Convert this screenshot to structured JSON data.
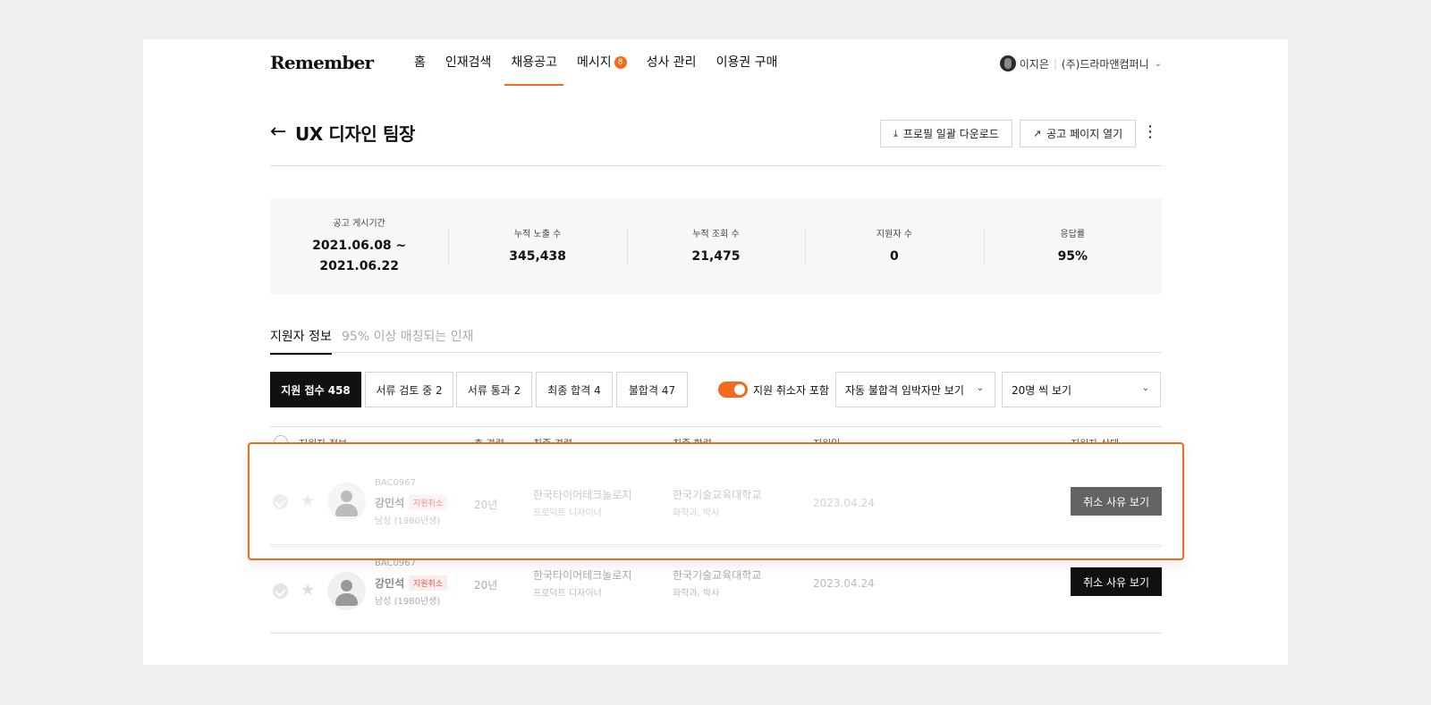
{
  "nav": {
    "logo": "Remember",
    "items": [
      {
        "label": "홈",
        "active": false
      },
      {
        "label": "인재검색",
        "active": false
      },
      {
        "label": "채용공고",
        "active": true
      },
      {
        "label": "메시지",
        "active": false,
        "badge": "8"
      },
      {
        "label": "성사 관리",
        "active": false
      },
      {
        "label": "이용권 구매",
        "active": false
      }
    ],
    "user_name": "이지은",
    "company": "(주)드라마앤컴퍼니"
  },
  "header": {
    "title": "UX 디자인 팀장",
    "download_label": "프로필 일괄 다운로드",
    "open_page_label": "공고 페이지 열기"
  },
  "stats": [
    {
      "label": "공고 게시기간",
      "value": "2021.06.08 ~",
      "value2": "2021.06.22"
    },
    {
      "label": "누적 노출 수",
      "value": "345,438"
    },
    {
      "label": "누적 조회 수",
      "value": "21,475"
    },
    {
      "label": "지원자 수",
      "value": "0"
    },
    {
      "label": "응답률",
      "value": "95%"
    }
  ],
  "tabs": [
    {
      "label": "지원자 정보",
      "active": true
    },
    {
      "label": "95% 이상 매칭되는 인재",
      "active": false
    }
  ],
  "filters": {
    "chips": [
      {
        "label": "지원 접수 458",
        "active": true
      },
      {
        "label": "서류 검토 중 2",
        "active": false
      },
      {
        "label": "서류 통과 2",
        "active": false
      },
      {
        "label": "최종 합격 4",
        "active": false
      },
      {
        "label": "불합격 47",
        "active": false
      }
    ],
    "toggle_label": "지원 취소자 포함",
    "toggle_on": true,
    "select1": "자동 불합격 임박자만 보기",
    "select2": "20명 씩 보기"
  },
  "table": {
    "columns": [
      "지원자 정보",
      "총 경력",
      "최종 경력",
      "최종 학력",
      "지원일",
      "지원자 상태"
    ],
    "rows": [
      {
        "code": "BAC0967",
        "name": "강민석",
        "tag": "지원취소",
        "meta": "남성 (1980년생)",
        "career": "20년",
        "company": "한국타이어테크놀로지",
        "role": "프로덕트 디자이너",
        "school": "한국기술교육대학교",
        "major": "화학과, 박사",
        "date": "2023.04.24",
        "action": "취소 사유 보기"
      },
      {
        "code": "BAC0967",
        "name": "강민석",
        "tag": "지원취소",
        "meta": "남성 (1980년생)",
        "career": "20년",
        "company": "한국타이어테크놀로지",
        "role": "프로덕트 디자이너",
        "school": "한국기술교육대학교",
        "major": "화학과, 박사",
        "date": "2023.04.24",
        "action": "취소 사유 보기"
      }
    ]
  },
  "colors": {
    "accent": "#f26a1b",
    "primary_button": "#111111",
    "tag_red": "#ef5350",
    "background": "#efefef"
  }
}
